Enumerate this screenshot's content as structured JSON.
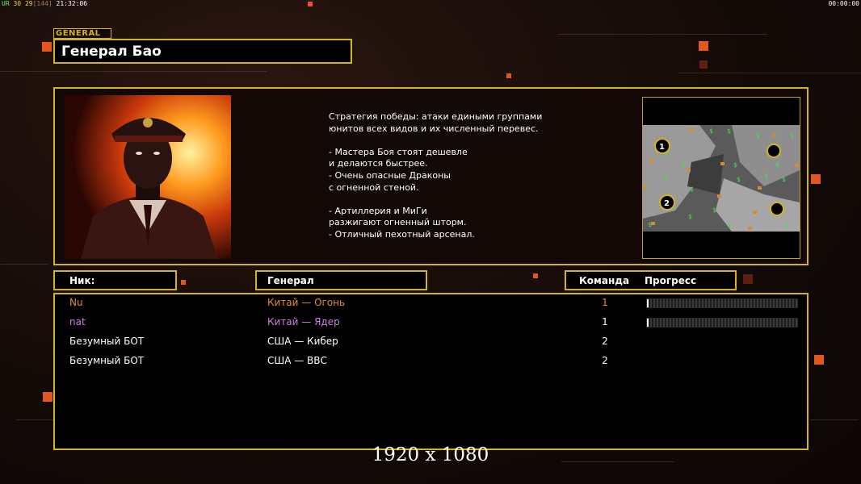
{
  "hud": {
    "fps_label": "UR",
    "fps_value": "30",
    "fps_secondary": "29",
    "ping": "[144]",
    "clock": "21:32:06",
    "game_timer": "00:00:00"
  },
  "general_tag": "GENERAL",
  "general_name": "Генерал Бао",
  "description": "Стратегия победы: атаки едиными группами\nюнитов всех видов и их численный перевес.\n\n- Мастера Боя стоят дешевле\nи делаются быстрее.\n- Очень опасные Драконы\nс огненной стеной.\n\n- Артиллерия и МиГи\nразжигают огненный шторм.\n- Отличный пехотный арсенал.",
  "columns": {
    "nick": "Ник:",
    "general": "Генерал",
    "team": "Команда",
    "progress": "Прогресс"
  },
  "players": [
    {
      "nick": "Nu",
      "general": "Китай — Огонь",
      "team": "1",
      "color": "#e58a3c",
      "progress": 0.01
    },
    {
      "nick": "nat",
      "general": "Китай — Ядер",
      "team": "1",
      "color": "#cf7fe0",
      "progress": 0.01
    },
    {
      "nick": "Безумный БОТ",
      "general": "США — Кибер",
      "team": "2",
      "color": "#ffffff"
    },
    {
      "nick": "Безумный БОТ",
      "general": "США — ВВС",
      "team": "2",
      "color": "#ffffff"
    }
  ],
  "minimap": {
    "start_positions": [
      "1",
      "2"
    ]
  },
  "resolution_overlay": "1920 x 1080",
  "colors": {
    "accent_border": "#d6b319",
    "player1": "#e58a3c",
    "player2": "#cf7fe0"
  }
}
